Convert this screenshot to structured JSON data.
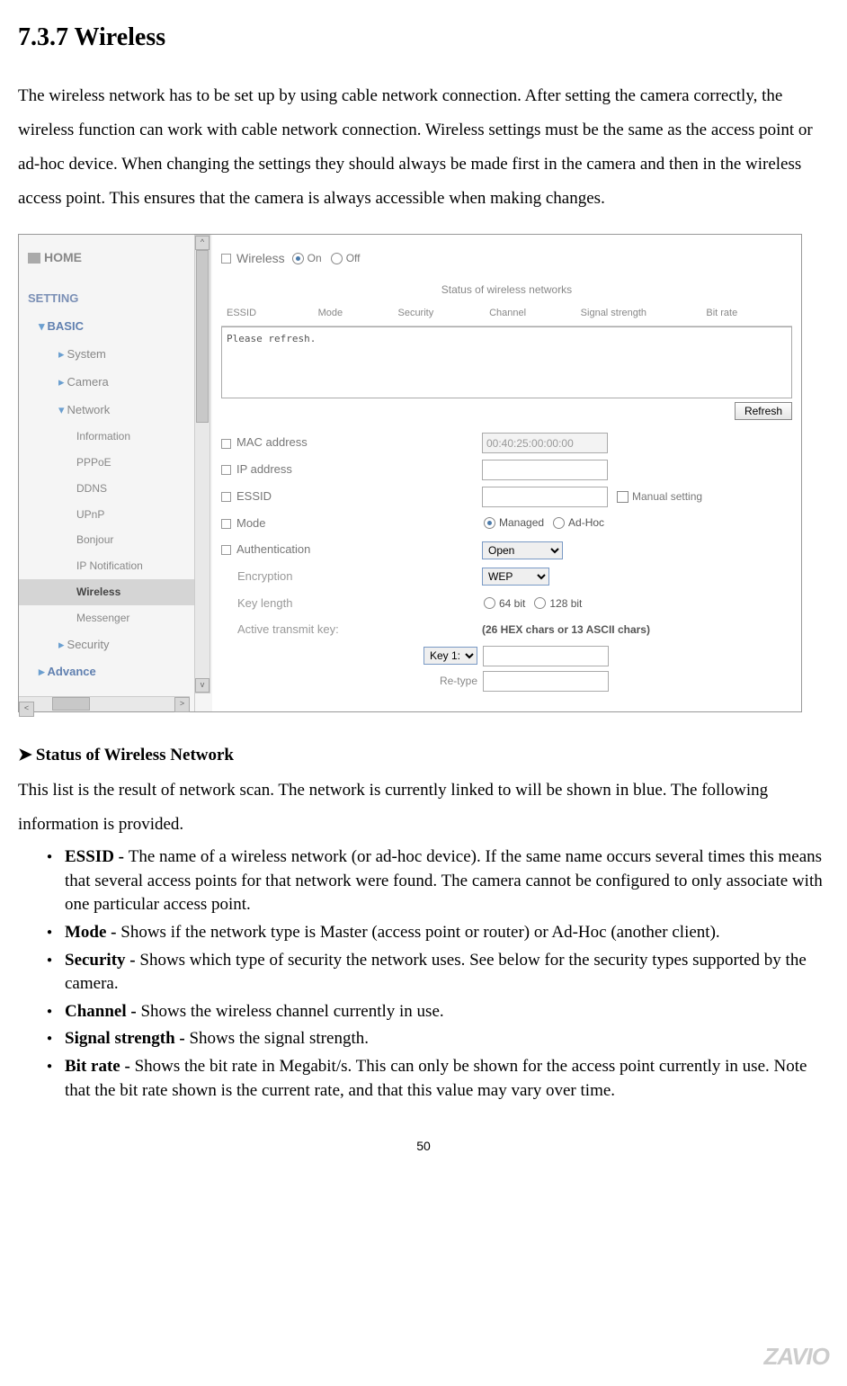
{
  "title": "7.3.7 Wireless",
  "intro": "The wireless network has to be set up by using cable network connection. After setting the camera correctly, the wireless function can work with cable network connection. Wireless settings must be the same as the access point or ad-hoc device. When changing the settings they should always be made first in the camera and then in the wireless access point. This ensures that the camera is always accessible when making changes.",
  "nav": {
    "home": "HOME",
    "setting": "SETTING",
    "basic": "BASIC",
    "items": [
      "System",
      "Camera",
      "Network"
    ],
    "subitems": [
      "Information",
      "PPPoE",
      "DDNS",
      "UPnP",
      "Bonjour",
      "IP Notification",
      "Wireless",
      "Messenger"
    ],
    "security": "Security",
    "advance": "Advance"
  },
  "panel": {
    "wireless": "Wireless",
    "on": "On",
    "off": "Off",
    "status_title": "Status of wireless networks",
    "cols": [
      "ESSID",
      "Mode",
      "Security",
      "Channel",
      "Signal strength",
      "Bit rate"
    ],
    "refresh_msg": "Please refresh.",
    "refresh_btn": "Refresh",
    "mac": "MAC address",
    "mac_value": "00:40:25:00:00:00",
    "ip": "IP address",
    "essid": "ESSID",
    "manual": "Manual setting",
    "mode": "Mode",
    "managed": "Managed",
    "adhoc": "Ad-Hoc",
    "auth": "Authentication",
    "auth_value": "Open",
    "enc": "Encryption",
    "enc_value": "WEP",
    "keylen": "Key length",
    "bit64": "64 bit",
    "bit128": "128 bit",
    "atk": "Active transmit key:",
    "atk_note": "(26 HEX chars or 13 ASCII chars)",
    "key1": "Key 1:",
    "retype": "Re-type"
  },
  "section": {
    "head": "Status of Wireless Network",
    "desc": "This list is the result of network scan. The network is currently linked to will be shown in blue. The following information is provided.",
    "b1t": "ESSID - ",
    "b1": "The name of a wireless network (or ad-hoc device). If the same name occurs several times this means that several access points for that network were found. The camera cannot be configured to only associate with one particular access point.",
    "b2t": "Mode - ",
    "b2": "Shows if the network type is Master (access point or router) or Ad-Hoc (another client).",
    "b3t": "Security - ",
    "b3": "Shows which type of security the network uses. See below for the security types supported by the camera.",
    "b4t": "Channel - ",
    "b4": "Shows the wireless channel currently in use.",
    "b5t": "Signal strength - ",
    "b5": "Shows the signal strength.",
    "b6t": "Bit rate - ",
    "b6": "Shows the bit rate in Megabit/s. This can only be shown for the access point currently in use. Note that the bit rate shown is the current rate, and that this value may vary over time."
  },
  "pagenum": "50",
  "logo": "ZAVIO"
}
